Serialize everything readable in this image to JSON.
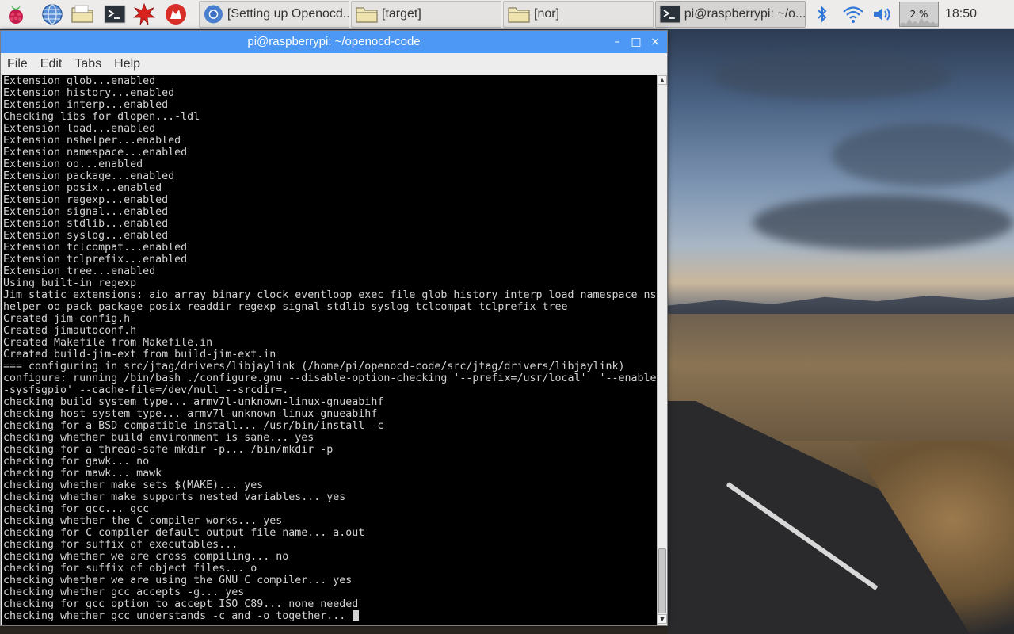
{
  "panel": {
    "launchers": [
      {
        "name": "raspberry-menu",
        "icon": "raspberry-icon"
      },
      {
        "name": "web-browser",
        "icon": "globe-icon"
      },
      {
        "name": "file-manager",
        "icon": "folder-icon"
      },
      {
        "name": "terminal",
        "icon": "terminal-icon"
      },
      {
        "name": "math-kernel",
        "icon": "mathematica-icon"
      },
      {
        "name": "wolfram",
        "icon": "wolfram-icon"
      }
    ],
    "tasks": [
      {
        "label": "[Setting up Openocd...",
        "icon": "chromium-icon",
        "active": false
      },
      {
        "label": "[target]",
        "icon": "folder-icon",
        "active": false
      },
      {
        "label": "[nor]",
        "icon": "folder-icon",
        "active": false
      },
      {
        "label": "pi@raspberrypi: ~/o...",
        "icon": "terminal-icon",
        "active": true
      }
    ],
    "cpu_label": "2 %",
    "clock": "18:50"
  },
  "window": {
    "title": "pi@raspberrypi: ~/openocd-code",
    "menu": [
      "File",
      "Edit",
      "Tabs",
      "Help"
    ],
    "controls": {
      "minimize": "–",
      "maximize": "□",
      "close": "×"
    }
  },
  "terminal": {
    "lines": [
      "Extension glob...enabled",
      "Extension history...enabled",
      "Extension interp...enabled",
      "Checking libs for dlopen...-ldl",
      "Extension load...enabled",
      "Extension nshelper...enabled",
      "Extension namespace...enabled",
      "Extension oo...enabled",
      "Extension package...enabled",
      "Extension posix...enabled",
      "Extension regexp...enabled",
      "Extension signal...enabled",
      "Extension stdlib...enabled",
      "Extension syslog...enabled",
      "Extension tclcompat...enabled",
      "Extension tclprefix...enabled",
      "Extension tree...enabled",
      "Using built-in regexp",
      "Jim static extensions: aio array binary clock eventloop exec file glob history interp load namespace ns",
      "helper oo pack package posix readdir regexp signal stdlib syslog tclcompat tclprefix tree",
      "Created jim-config.h",
      "Created jimautoconf.h",
      "Created Makefile from Makefile.in",
      "Created build-jim-ext from build-jim-ext.in",
      "=== configuring in src/jtag/drivers/libjaylink (/home/pi/openocd-code/src/jtag/drivers/libjaylink)",
      "configure: running /bin/bash ./configure.gnu --disable-option-checking '--prefix=/usr/local'  '--enable",
      "-sysfsgpio' --cache-file=/dev/null --srcdir=.",
      "checking build system type... armv7l-unknown-linux-gnueabihf",
      "checking host system type... armv7l-unknown-linux-gnueabihf",
      "checking for a BSD-compatible install... /usr/bin/install -c",
      "checking whether build environment is sane... yes",
      "checking for a thread-safe mkdir -p... /bin/mkdir -p",
      "checking for gawk... no",
      "checking for mawk... mawk",
      "checking whether make sets $(MAKE)... yes",
      "checking whether make supports nested variables... yes",
      "checking for gcc... gcc",
      "checking whether the C compiler works... yes",
      "checking for C compiler default output file name... a.out",
      "checking for suffix of executables...",
      "checking whether we are cross compiling... no",
      "checking for suffix of object files... o",
      "checking whether we are using the GNU C compiler... yes",
      "checking whether gcc accepts -g... yes",
      "checking for gcc option to accept ISO C89... none needed",
      "checking whether gcc understands -c and -o together... "
    ]
  }
}
